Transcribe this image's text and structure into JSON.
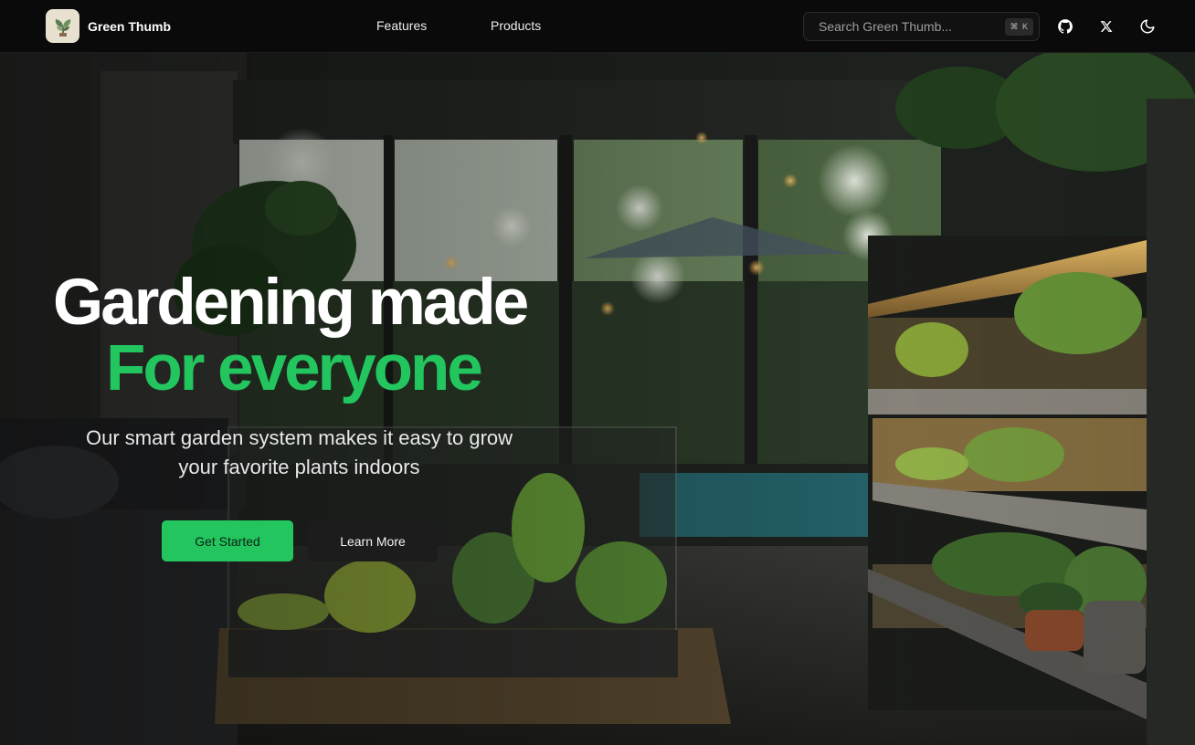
{
  "nav": {
    "brand_name": "Green Thumb",
    "links": [
      "Features",
      "Products"
    ],
    "search_placeholder": "Search Green Thumb...",
    "search_shortcut": "⌘ K",
    "icons": [
      "github-icon",
      "x-icon",
      "moon-icon"
    ]
  },
  "hero": {
    "title_line1": "Gardening made",
    "title_line2": "For everyone",
    "subtitle": "Our smart garden system makes it easy to grow your favorite plants indoors",
    "primary_button": "Get Started",
    "secondary_button": "Learn More"
  },
  "colors": {
    "accent": "#22c55e",
    "nav_bg": "#0a0a0a",
    "secondary_button_bg": "#1c1c1c"
  }
}
